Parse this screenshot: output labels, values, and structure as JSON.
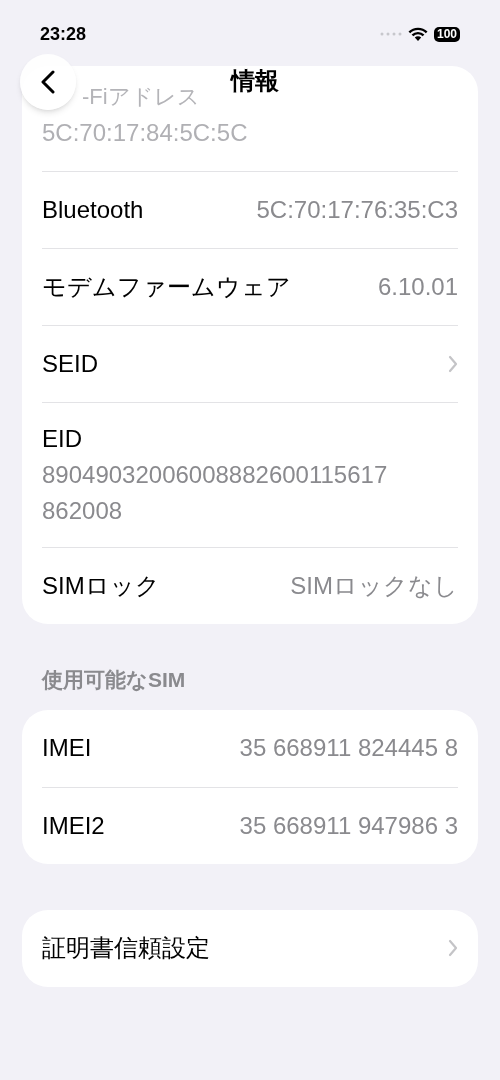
{
  "status_bar": {
    "time": "23:28",
    "battery": "100"
  },
  "nav": {
    "title": "情報"
  },
  "sections": [
    {
      "rows": [
        {
          "kind": "faded",
          "label": "-Fiアドレス",
          "value": "5C:70:17:84:5C:5C"
        },
        {
          "kind": "value",
          "label": "Bluetooth",
          "value": "5C:70:17:76:35:C3"
        },
        {
          "kind": "value",
          "label": "モデムファームウェア",
          "value": "6.10.01"
        },
        {
          "kind": "chevron",
          "label": "SEID"
        },
        {
          "kind": "stacked",
          "label": "EID",
          "value": "89049032006008882600115617862008"
        },
        {
          "kind": "value",
          "label": "SIMロック",
          "value": "SIMロックなし"
        }
      ]
    },
    {
      "header": "使用可能なSIM",
      "rows": [
        {
          "kind": "value",
          "label": "IMEI",
          "value": "35 668911 824445 8"
        },
        {
          "kind": "value",
          "label": "IMEI2",
          "value": "35 668911 947986 3"
        }
      ]
    },
    {
      "rows": [
        {
          "kind": "chevron",
          "label": "証明書信頼設定"
        }
      ]
    }
  ]
}
